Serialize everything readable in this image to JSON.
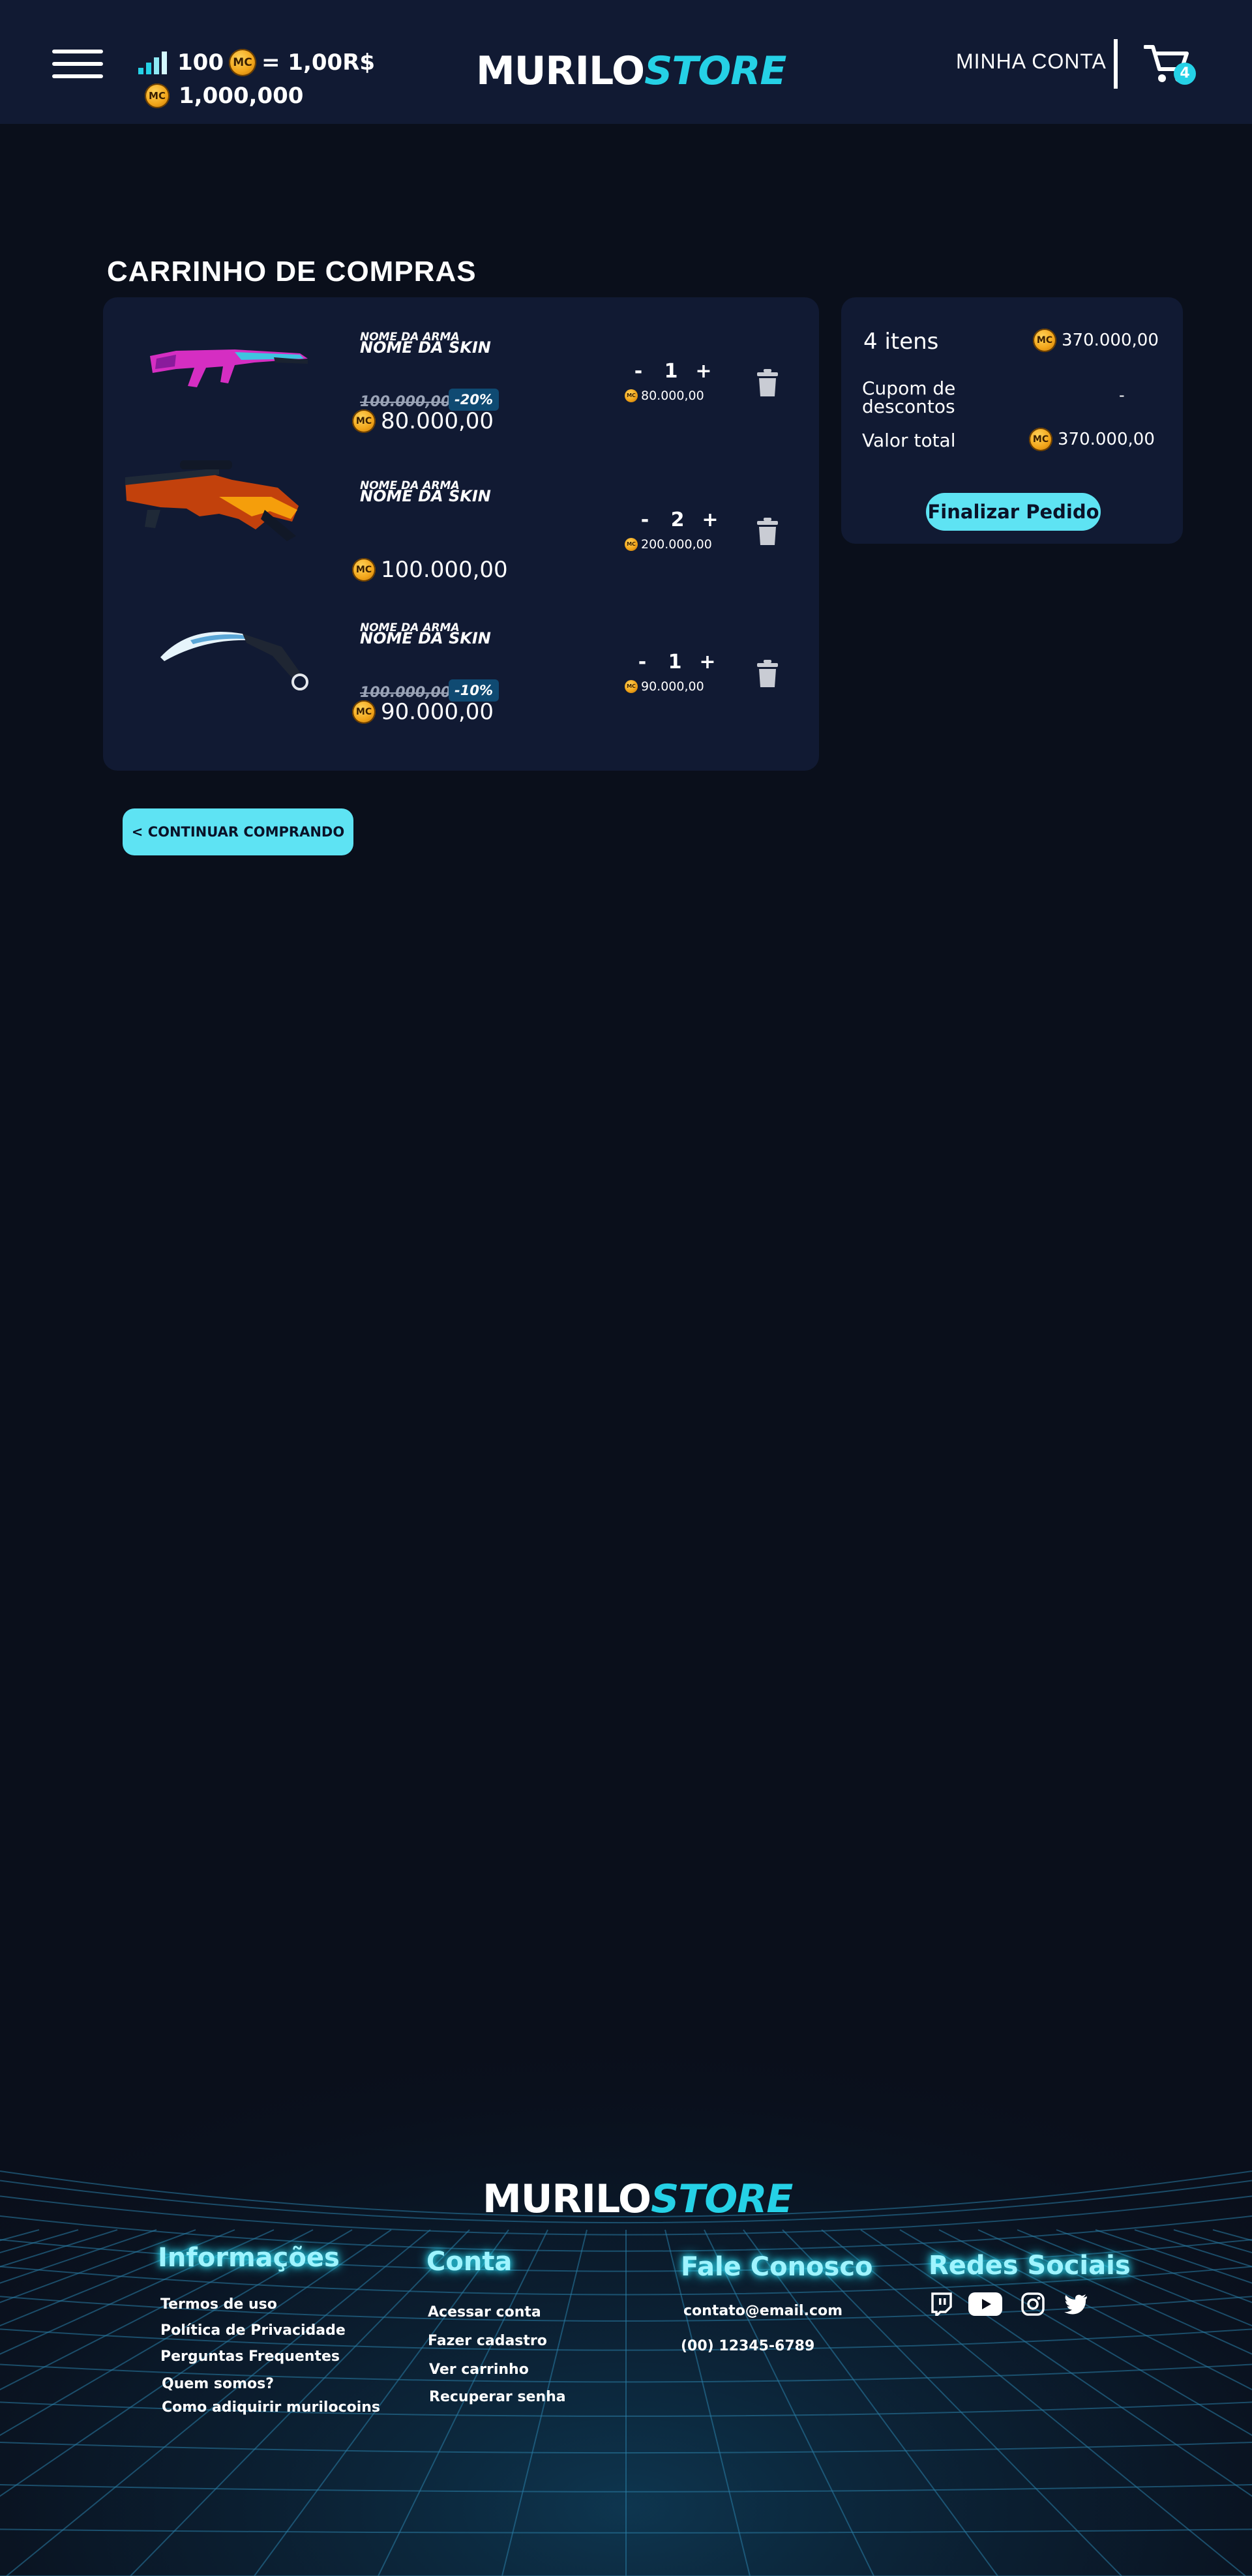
{
  "header": {
    "exchange_amount": "100",
    "coin_label": "MC",
    "exchange_value": "= 1,00R$",
    "balance": "1,000,000",
    "logo_part1": "MURILO",
    "logo_part2": "STORE",
    "account_label": "MINHA CONTA",
    "cart_count": "4"
  },
  "colors": {
    "accent": "#25d1e6",
    "button": "#5ee3f3",
    "panel": "#111a33",
    "background": "#0a0f1b",
    "coin": "#f2a51a"
  },
  "cart": {
    "title": "CARRINHO DE COMPRAS",
    "items": [
      {
        "weapon": "NOME DA ARMA",
        "skin": "NOME DA SKIN",
        "old_price": "100.000,00",
        "discount": "-20%",
        "price": "80.000,00",
        "qty": "1",
        "subtotal": "80.000,00",
        "image": "ak47-pink-icon"
      },
      {
        "weapon": "NOME DA ARMA",
        "skin": "NOME DA SKIN",
        "price": "100.000,00",
        "qty": "2",
        "subtotal": "200.000,00",
        "image": "awp-dragon-icon"
      },
      {
        "weapon": "NOME DA ARMA",
        "skin": "NOME DA SKIN",
        "old_price": "100.000,00",
        "discount": "-10%",
        "price": "90.000,00",
        "qty": "1",
        "subtotal": "90.000,00",
        "image": "karambit-knife-icon"
      }
    ],
    "minus": "-",
    "plus": "+",
    "continue_label": "< CONTINUAR COMPRANDO"
  },
  "summary": {
    "items_count": "4 itens",
    "items_total": "370.000,00",
    "coupon_line1": "Cupom de",
    "coupon_line2": "descontos",
    "coupon_value": "-",
    "total_label": "Valor total",
    "total_value": "370.000,00",
    "checkout_label": "Finalizar Pedido"
  },
  "footer": {
    "logo_part1": "MURILO",
    "logo_part2": "STORE",
    "info_title": "Informações",
    "info_links": [
      "Termos de uso",
      "Política de Privacidade",
      "Perguntas Frequentes",
      "Quem somos?",
      "Como adiquirir murilocoins"
    ],
    "account_title": "Conta",
    "account_links": [
      "Acessar conta",
      "Fazer cadastro",
      "Ver carrinho",
      "Recuperar senha"
    ],
    "contact_title": "Fale Conosco",
    "contact_email": "contato@email.com",
    "contact_phone": "(00) 12345-6789",
    "social_title": "Redes Sociais",
    "social_icons": [
      "twitch-icon",
      "youtube-icon",
      "instagram-icon",
      "twitter-icon"
    ]
  }
}
